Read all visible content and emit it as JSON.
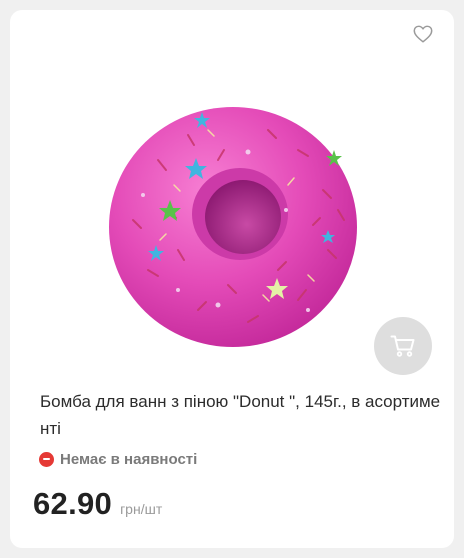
{
  "product": {
    "name": "Бомба для ванн з піною \"Donut \", 145г., в асортименті",
    "availability": "Немає в наявності",
    "price": "62.90",
    "unit": "грн/шт"
  },
  "icons": {
    "favorite": "heart-icon",
    "cart": "cart-icon",
    "availability": "minus-circle-icon"
  },
  "colors": {
    "availability_status": "#e53935",
    "cart_button_bg": "#dedede",
    "product_pink": "#e23fb3"
  }
}
